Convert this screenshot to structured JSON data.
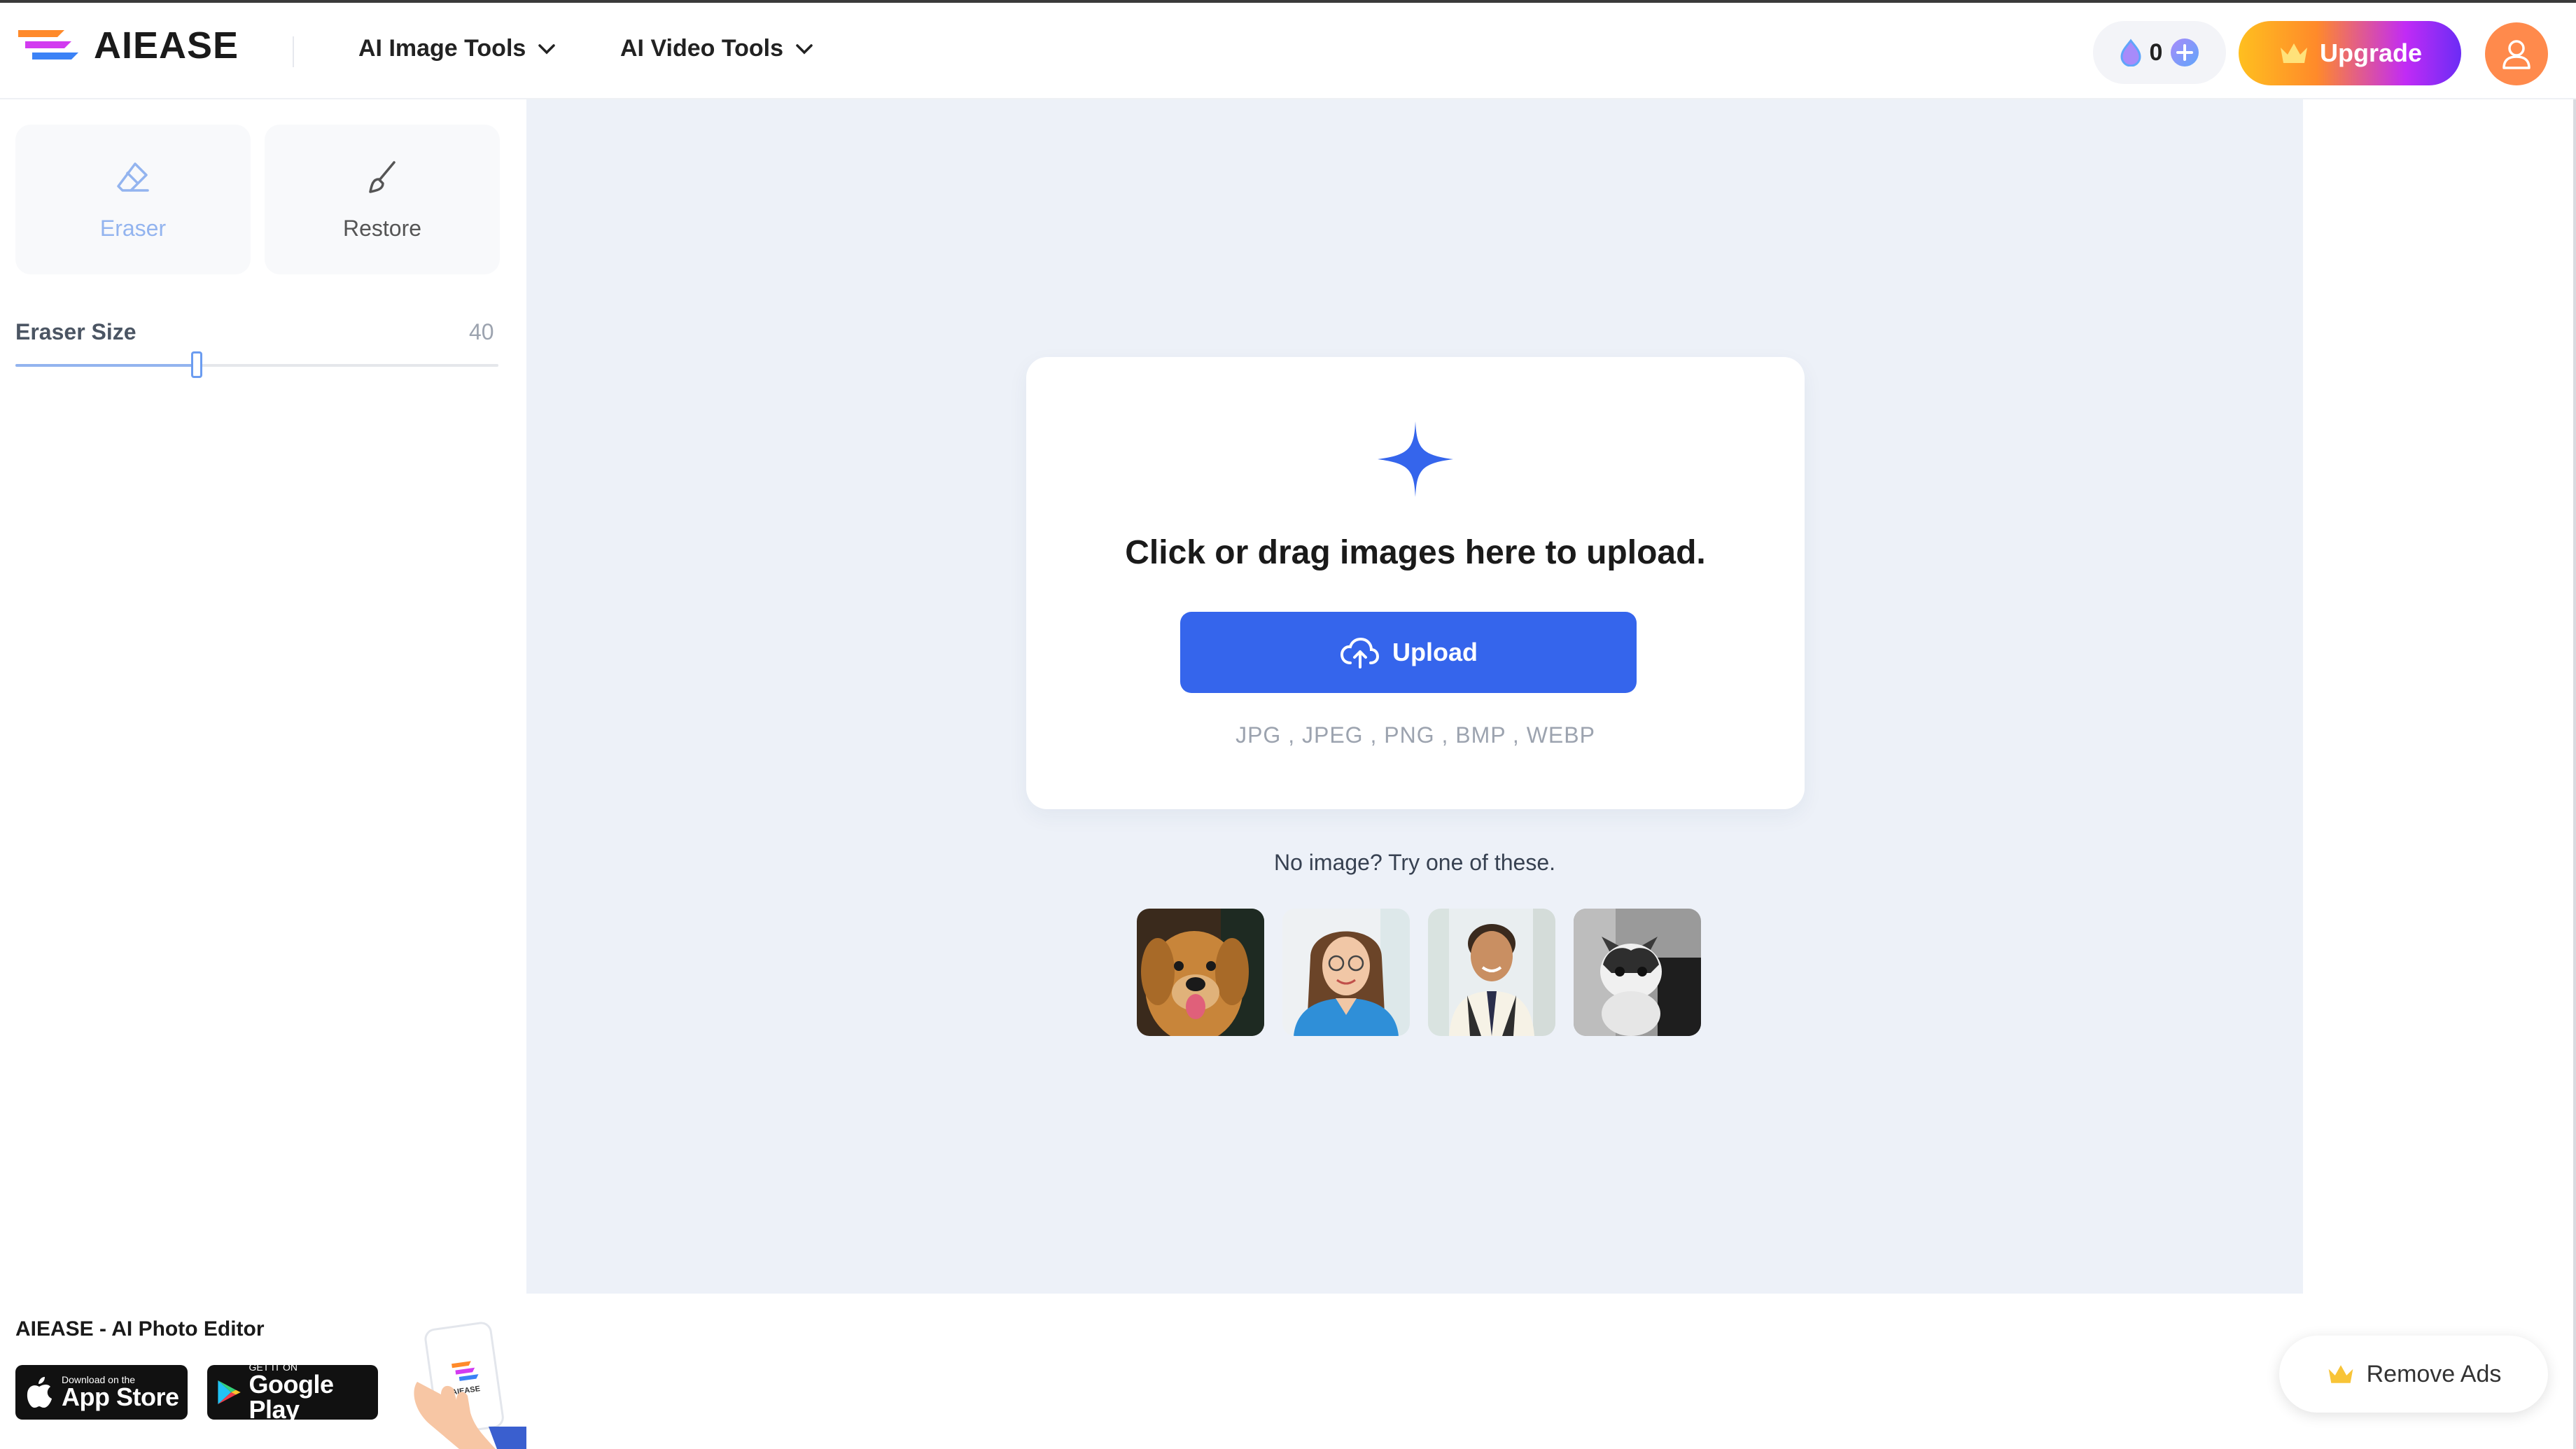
{
  "header": {
    "brand": "AIEASE",
    "nav": [
      {
        "label": "AI Image Tools"
      },
      {
        "label": "AI Video Tools"
      }
    ],
    "credits": "0",
    "upgrade_label": "Upgrade"
  },
  "sidebar": {
    "tools": [
      {
        "label": "Eraser",
        "icon": "eraser-icon",
        "active": true
      },
      {
        "label": "Restore",
        "icon": "brush-icon",
        "active": false
      }
    ],
    "eraser_size_label": "Eraser Size",
    "eraser_size_value": "40",
    "eraser_size_fraction": 0.375,
    "app": {
      "title": "AIEASE - AI Photo Editor",
      "app_store_small": "Download on the",
      "app_store_big": "App Store",
      "google_play_small": "GET IT ON",
      "google_play_big": "Google Play",
      "phone_logo_text": "AIEASE"
    }
  },
  "upload": {
    "title": "Click or drag images here to upload.",
    "button_label": "Upload",
    "formats": "JPG , JPEG , PNG , BMP , WEBP",
    "try_text": "No image? Try one of these.",
    "samples": [
      "dog-photo",
      "woman-doctor-photo",
      "boy-photo",
      "cat-photo"
    ]
  },
  "remove_ads": {
    "label": "Remove Ads"
  },
  "colors": {
    "accent": "#3565ec",
    "canvas_bg": "#edf1f8",
    "avatar": "#ff8a4c"
  }
}
